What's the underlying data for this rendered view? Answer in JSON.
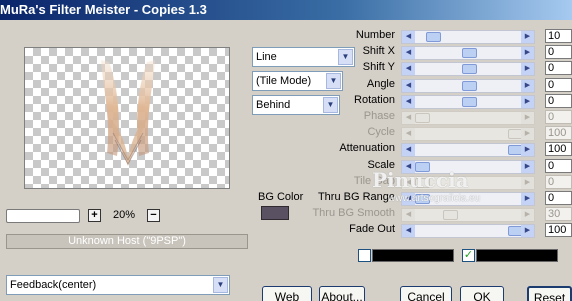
{
  "window": {
    "title": "MuRa's Filter Meister - Copies 1.3"
  },
  "preview": {
    "zoom_value": "",
    "zoom_percent": "20%",
    "plus_label": "+",
    "minus_label": "−",
    "host_label": "Unknown Host (\"9PSP\")"
  },
  "dropdowns": {
    "mode": "Line",
    "tile": "(Tile Mode)",
    "order": "Behind",
    "feedback": "Feedback(center)"
  },
  "bg_color": {
    "label": "BG Color",
    "swatch": "#5a5262"
  },
  "params": [
    {
      "label": "Number",
      "value": "10",
      "fill": 0.12,
      "enabled": true
    },
    {
      "label": "Shift X",
      "value": "0",
      "fill": 0.5,
      "enabled": true
    },
    {
      "label": "Shift Y",
      "value": "0",
      "fill": 0.5,
      "enabled": true
    },
    {
      "label": "Angle",
      "value": "0",
      "fill": 0.5,
      "enabled": true
    },
    {
      "label": "Rotation",
      "value": "0",
      "fill": 0.5,
      "enabled": true
    },
    {
      "label": "Phase",
      "value": "0",
      "fill": 0.0,
      "enabled": false
    },
    {
      "label": "Cycle",
      "value": "100",
      "fill": 1.0,
      "enabled": false
    },
    {
      "label": "Attenuation",
      "value": "100",
      "fill": 1.0,
      "enabled": true
    },
    {
      "label": "Scale",
      "value": "0",
      "fill": 0.0,
      "enabled": true
    },
    {
      "label": "Tile Gap",
      "value": "0",
      "fill": 0.0,
      "enabled": false
    },
    {
      "label": "Thru BG Range",
      "value": "0",
      "fill": 0.0,
      "enabled": true
    },
    {
      "label": "Thru BG Smooth",
      "value": "30",
      "fill": 0.3,
      "enabled": false
    },
    {
      "label": "Fade Out",
      "value": "100",
      "fill": 1.0,
      "enabled": true
    }
  ],
  "checkbox_checked_glyph": "✓",
  "watermark": {
    "text": "Pinuccia",
    "url": "www.artsograficia.eu"
  },
  "buttons": {
    "web": "Web",
    "about": "About...",
    "cancel": "Cancel",
    "ok": "OK",
    "reset": "Reset"
  }
}
